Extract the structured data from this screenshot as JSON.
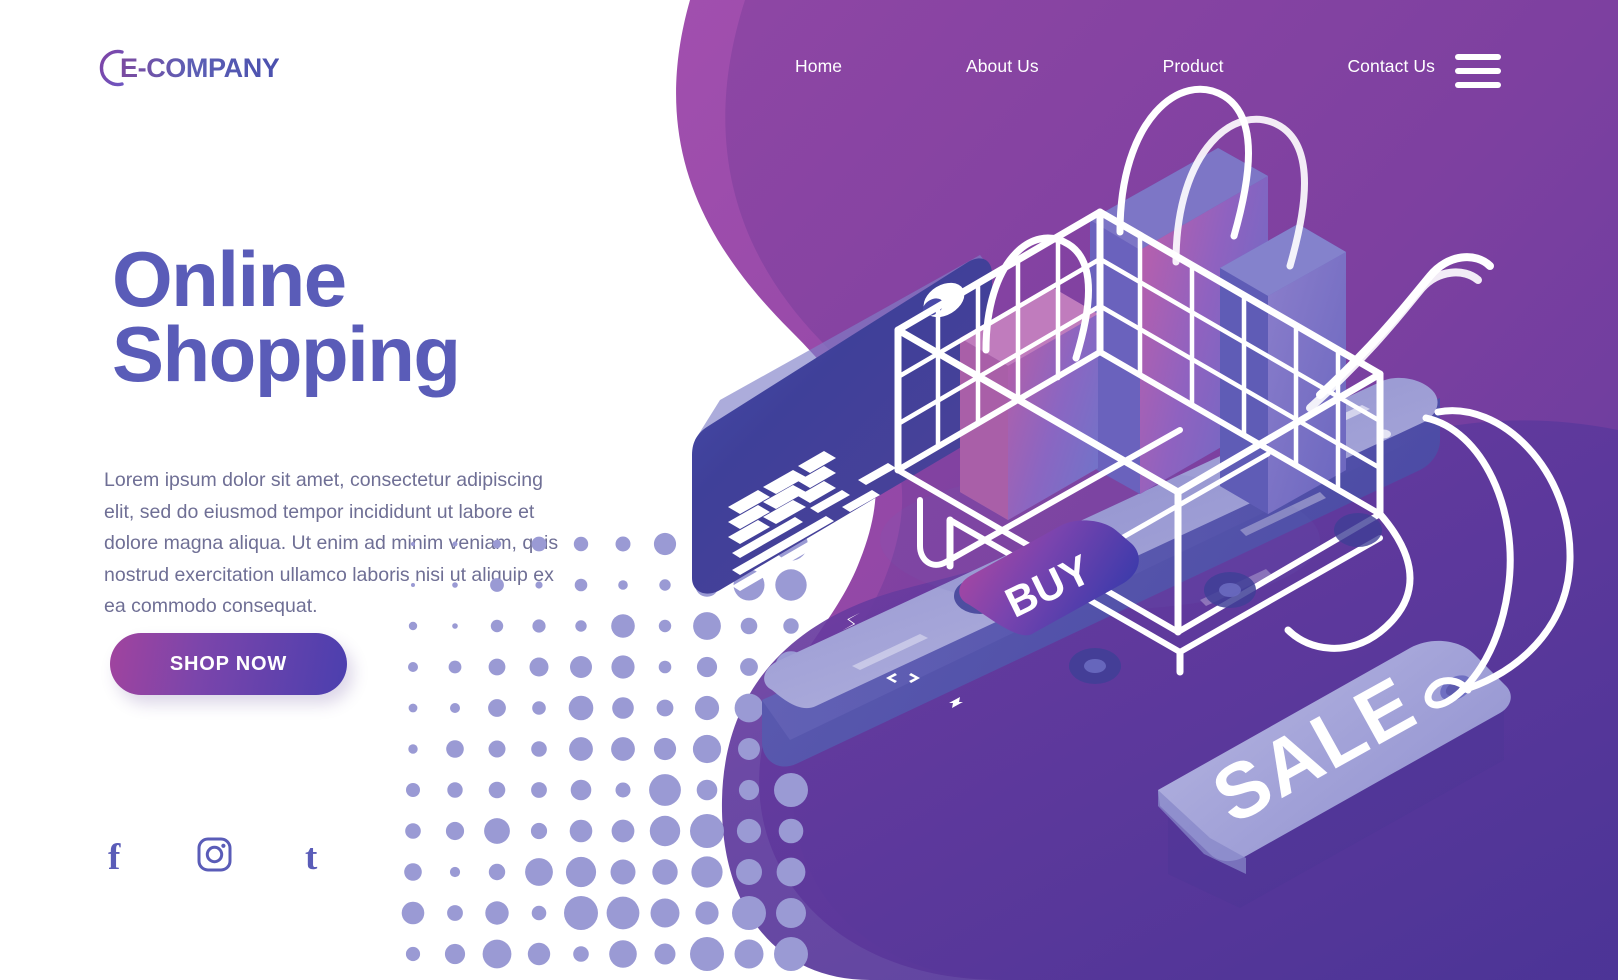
{
  "brand": {
    "logo_text": "E-COMPANY",
    "logo_icon": "c-arc-icon"
  },
  "nav": {
    "items": [
      {
        "label": "Home"
      },
      {
        "label": "About Us"
      },
      {
        "label": "Product"
      },
      {
        "label": "Contact Us"
      }
    ],
    "menu_icon": "hamburger-menu-icon"
  },
  "hero": {
    "headline_line1": "Online",
    "headline_line2": "Shopping",
    "paragraph": "Lorem ipsum dolor sit amet, consectetur adipiscing elit, sed do eiusmod tempor incididunt ut labore et dolore magna aliqua. Ut enim ad minim veniam, quis nostrud exercitation ullamco laboris nisi ut aliquip ex ea commodo consequat.",
    "cta_label": "SHOP NOW"
  },
  "social": {
    "facebook_label": "f",
    "facebook_icon": "facebook-icon",
    "instagram_icon": "instagram-icon",
    "tumblr_label": "t",
    "tumblr_icon": "tumblr-icon"
  },
  "illustration": {
    "buy_label": "BUY",
    "sale_label": "SALE",
    "phone_icon": "smartphone-icon",
    "card_icon": "credit-card-icon",
    "cart_icon": "shopping-cart-icon",
    "bag_icon": "shopping-bag-icon",
    "tag_icon": "price-tag-icon"
  },
  "colors": {
    "heading": "#5a5cb8",
    "body_text": "#6f6f95",
    "blob_outer": "#9a4fa8",
    "blob_inner": "#7b4399",
    "blob_bottom": "#5b3597",
    "halftone_dot": "#9a9ad4",
    "nav_text": "#ffffff",
    "cta_gradient_start": "#a1449e",
    "cta_gradient_end": "#4b3fae",
    "card_dark": "#3f3f9e",
    "phone_screen": "#9c9cd3"
  }
}
